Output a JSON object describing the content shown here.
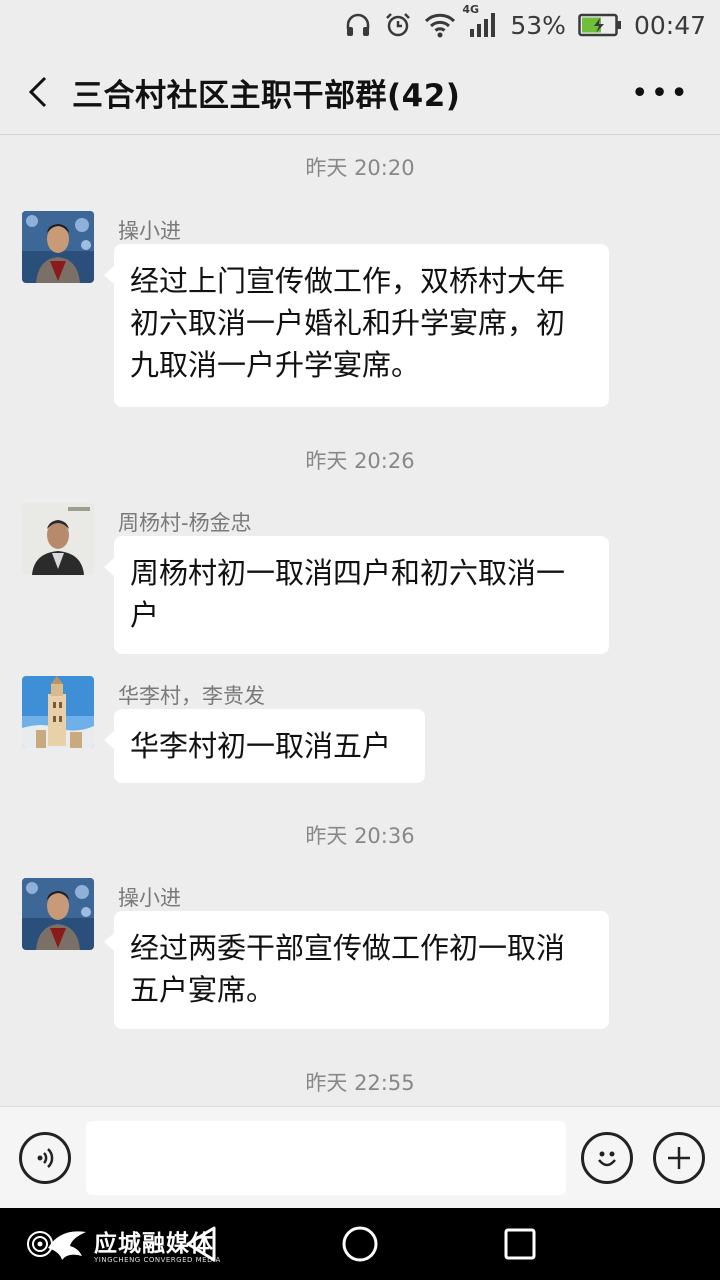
{
  "status_bar": {
    "network": "4G",
    "battery": "53%",
    "time": "00:47",
    "icons": [
      "headphones-icon",
      "alarm-icon",
      "wifi-icon",
      "signal-icon",
      "battery-charging-icon"
    ]
  },
  "header": {
    "title": "三合村社区主职干部群(42)",
    "back_icon": "chevron-left-icon",
    "more_icon": "more-dots-icon",
    "more_label": "•••"
  },
  "chat": {
    "timestamps": [
      "昨天 20:20",
      "昨天 20:26",
      "昨天 20:36",
      "昨天 22:55"
    ],
    "messages": [
      {
        "sender": "操小进",
        "text": "经过上门宣传做工作，双桥村大年初六取消一户婚礼和升学宴席，初九取消一户升学宴席。"
      },
      {
        "sender": "周杨村-杨金忠",
        "text": "周杨村初一取消四户和初六取消一户"
      },
      {
        "sender": "华李村，李贵发",
        "text": "华李村初一取消五户"
      },
      {
        "sender": "操小进",
        "text": "经过两委干部宣传做工作初一取消五户宴席。"
      }
    ]
  },
  "input_bar": {
    "voice_icon": "voice-icon",
    "emoji_icon": "emoji-icon",
    "add_icon": "plus-icon",
    "placeholder": ""
  },
  "nav_bar": {
    "back_icon": "nav-back-icon",
    "home_icon": "nav-home-icon",
    "recents_icon": "nav-recents-icon"
  },
  "watermark": {
    "main": "应城融媒体",
    "sub": "YINGCHENG CONVERGED MEDIA"
  },
  "colors": {
    "background": "#ededed",
    "bubble": "#ffffff",
    "nav": "#000000",
    "timestamp": "#888888"
  }
}
